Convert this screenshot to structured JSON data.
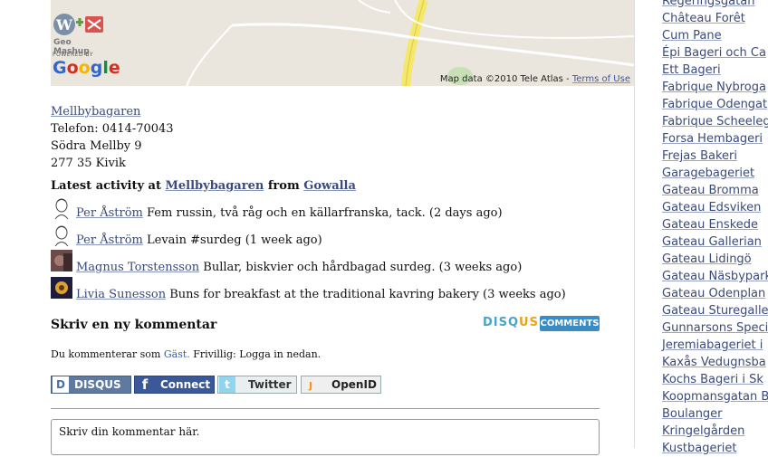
{
  "map": {
    "attribution": "Map data ©2010 Tele Atlas -",
    "terms_link": "Terms of Use",
    "geo_mashup_label": "Geo Mashup",
    "powered_by": "POWERED BY",
    "google_logo": "Google"
  },
  "address": {
    "name": "Mellbybagaren",
    "phone": "Telefon: 0414-70043",
    "street": "Södra Mellby 9",
    "postal": "277 35 Kivik"
  },
  "activity": {
    "heading_prefix": "Latest activity at",
    "place": "Mellbybagaren",
    "heading_mid": "from",
    "source": "Gowalla",
    "items": [
      {
        "user": "Per Åström",
        "text": "Fem russin, två råg och en källarfranska, tack. (2 days ago)"
      },
      {
        "user": "Per Åström",
        "text": "Levain #surdeg (1 week ago)"
      },
      {
        "user": "Magnus Torstensson",
        "text": "Bullar, biskvier och hårdbagad surdeg. (3 weeks ago)"
      },
      {
        "user": "Livia Sunesson",
        "text": "Buns for breakfast at the traditional kavring bakery (3 weeks ago)"
      }
    ]
  },
  "comments": {
    "heading": "Skriv en ny kommentar",
    "disqus_logo_a": "DISQ",
    "disqus_logo_b": "US",
    "badge": "COMMENTS",
    "guest_prefix": "Du kommenterar som",
    "guest_name": "Gäst.",
    "guest_suffix": "Frivillig: Logga in nedan.",
    "buttons": {
      "disqus": "DISQUS",
      "facebook": "Connect",
      "twitter": "Twitter",
      "openid": "OpenID"
    },
    "placeholder": "Skriv din kommentar här."
  },
  "sidebar": {
    "items": [
      "Regeringsgatan",
      "Château Forêt",
      "Cum Pane",
      "Épi Bageri och Ca",
      "Ett Bageri",
      "Fabrique Nybroga",
      "Fabrique Odengat",
      "Fabrique Scheeleg",
      "Forsa Hembageri",
      "Frejas Bakeri",
      "Garagebageriet",
      "Gateau Bromma",
      "Gateau Edsviken",
      "Gateau Enskede",
      "Gateau Gallerian",
      "Gateau Lidingö",
      "Gateau Näsbypark",
      "Gateau Odenplan",
      "Gateau Sturegalle",
      "Gunnarsons Speci",
      "Jeremiabageriet i",
      "Kaxås Vedugnsba",
      "Kochs Bageri i Sk",
      "Koopmansgatan B",
      "Boulanger",
      "Kringelgården",
      "Kustbageriet"
    ]
  }
}
